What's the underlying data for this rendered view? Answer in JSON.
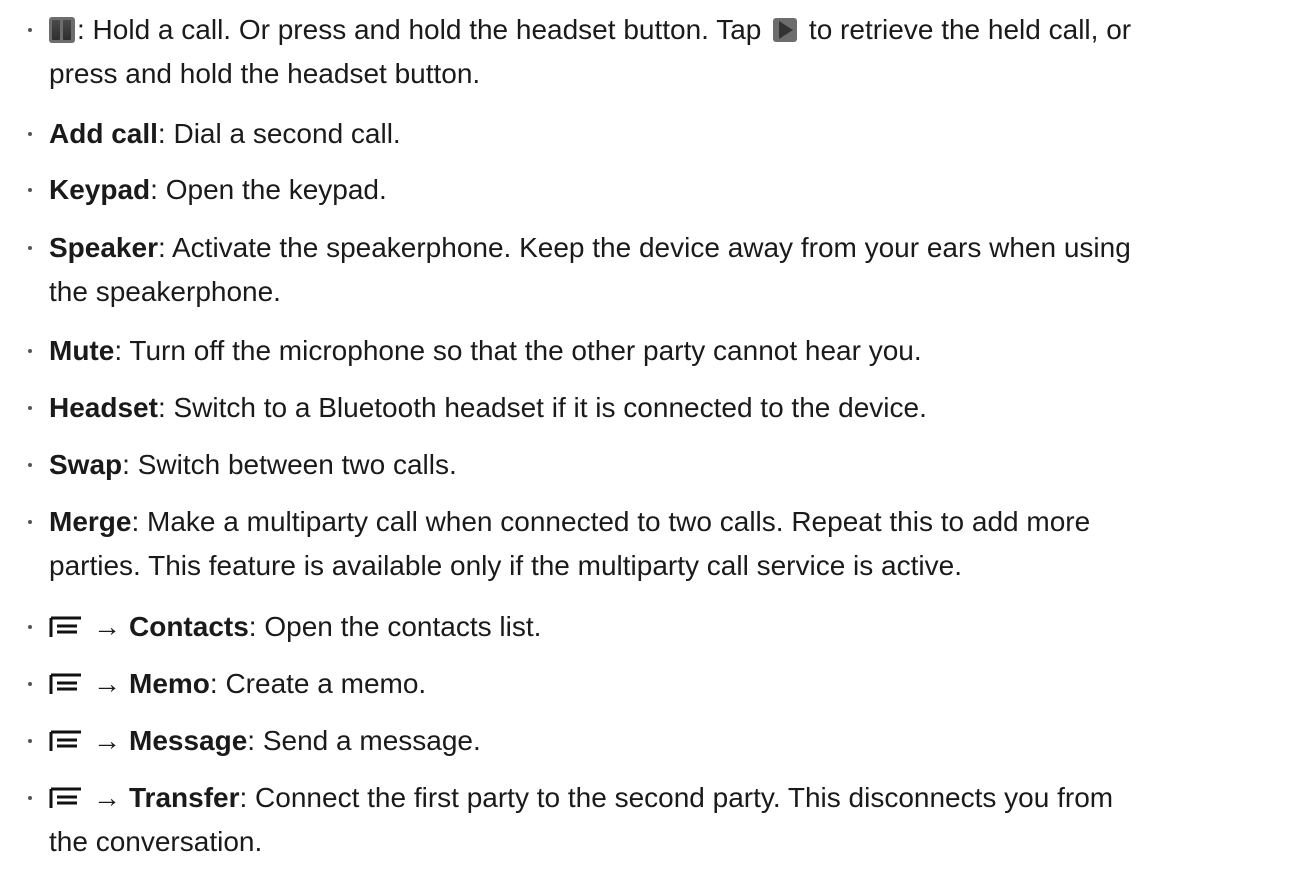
{
  "items": [
    {
      "icon": "pause-icon",
      "line1_pre": ": Hold a call. Or press and hold the headset button. Tap ",
      "inline_icon": "play-icon",
      "line1_post": " to retrieve the held call, or",
      "line2": "press and hold the headset button."
    },
    {
      "term": "Add call",
      "desc": ": Dial a second call."
    },
    {
      "term": "Keypad",
      "desc": ": Open the keypad."
    },
    {
      "term": "Speaker",
      "desc": ": Activate the speakerphone. Keep the device away from your ears when using",
      "line2": "the speakerphone."
    },
    {
      "term": "Mute",
      "desc": ": Turn off the microphone so that the other party cannot hear you."
    },
    {
      "term": "Headset",
      "desc": ": Switch to a Bluetooth headset if it is connected to the device."
    },
    {
      "term": "Swap",
      "desc": ": Switch between two calls."
    },
    {
      "term": "Merge",
      "desc": ": Make a multiparty call when connected to two calls. Repeat this to add more",
      "line2": "parties. This feature is available only if the multiparty call service is active."
    },
    {
      "icon": "menu-icon",
      "arrow": "→",
      "term": "Contacts",
      "desc": ": Open the contacts list."
    },
    {
      "icon": "menu-icon",
      "arrow": "→",
      "term": "Memo",
      "desc": ": Create a memo."
    },
    {
      "icon": "menu-icon",
      "arrow": "→",
      "term": "Message",
      "desc": ": Send a message."
    },
    {
      "icon": "menu-icon",
      "arrow": "→",
      "term": "Transfer",
      "desc": ": Connect the first party to the second party. This disconnects you from",
      "line2": "the conversation."
    }
  ]
}
